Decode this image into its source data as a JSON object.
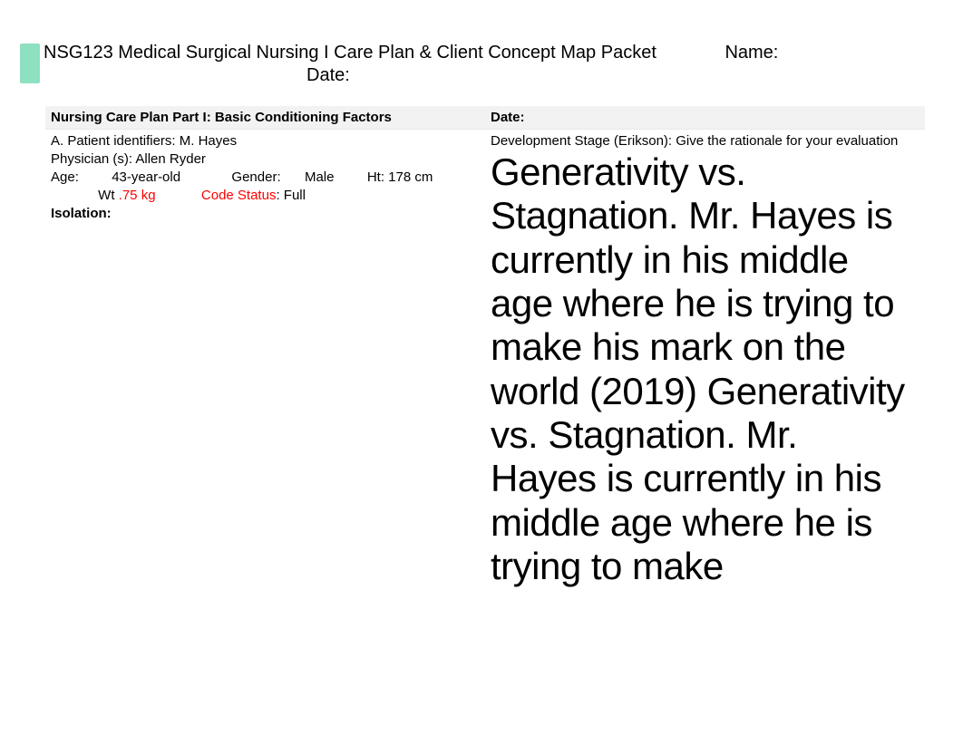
{
  "header": {
    "title": "NSG123 Medical Surgical Nursing I Care Plan & Client Concept Map Packet",
    "name_label": "Name:",
    "date_label": "Date:"
  },
  "left_col": {
    "heading": "Nursing Care Plan Part I: Basic Conditioning Factors",
    "patient_id_label": "A. Patient identifiers:",
    "patient_id_value": "M. Hayes",
    "physician_label": "Physician (s):",
    "physician_value": "Allen Ryder",
    "age_label": "Age:",
    "age_value": "43-year-old",
    "gender_label": "Gender:",
    "gender_value": "Male",
    "ht_label": "Ht:",
    "ht_value": "178 cm",
    "wt_label": "Wt",
    "wt_value": ".75 kg",
    "code_status_label": "Code Status",
    "code_status_value": ": Full",
    "isolation_label": "Isolation:"
  },
  "right_col": {
    "heading": "Date:",
    "dev_stage_label": "Development Stage (Erikson): Give the rationale for your evaluation",
    "body_text": "Generativity vs. Stagnation. Mr. Hayes is currently in his middle age where he is trying to make his mark on the world (2019) Generativity vs. Stagnation. Mr. Hayes is currently in his middle age where he is trying to make"
  }
}
